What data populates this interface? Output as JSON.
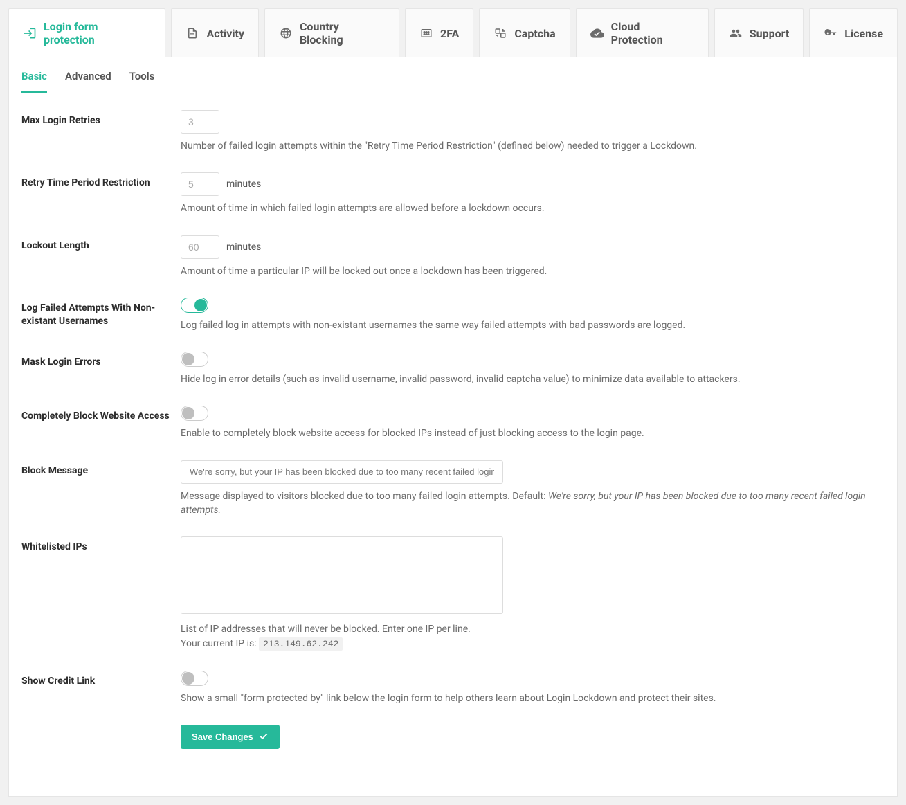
{
  "top_tabs": [
    {
      "label": "Login form protection"
    },
    {
      "label": "Activity"
    },
    {
      "label": "Country Blocking"
    },
    {
      "label": "2FA"
    },
    {
      "label": "Captcha"
    },
    {
      "label": "Cloud Protection"
    },
    {
      "label": "Support"
    },
    {
      "label": "License"
    }
  ],
  "sub_tabs": {
    "basic": "Basic",
    "advanced": "Advanced",
    "tools": "Tools"
  },
  "fields": {
    "max_login_retries": {
      "label": "Max Login Retries",
      "value": "3",
      "hint": "Number of failed login attempts within the \"Retry Time Period Restriction\" (defined below) needed to trigger a Lockdown."
    },
    "retry_time_period": {
      "label": "Retry Time Period Restriction",
      "value": "5",
      "unit": "minutes",
      "hint": "Amount of time in which failed login attempts are allowed before a lockdown occurs."
    },
    "lockout_length": {
      "label": "Lockout Length",
      "value": "60",
      "unit": "minutes",
      "hint": "Amount of time a particular IP will be locked out once a lockdown has been triggered."
    },
    "log_failed_nonexistant": {
      "label": "Log Failed Attempts With Non-existant Usernames",
      "hint": "Log failed log in attempts with non-existant usernames the same way failed attempts with bad passwords are logged."
    },
    "mask_login_errors": {
      "label": "Mask Login Errors",
      "hint": "Hide log in error details (such as invalid username, invalid password, invalid captcha value) to minimize data available to attackers."
    },
    "completely_block": {
      "label": "Completely Block Website Access",
      "hint": "Enable to completely block website access for blocked IPs instead of just blocking access to the login page."
    },
    "block_message": {
      "label": "Block Message",
      "placeholder": "We're sorry, but your IP has been blocked due to too many recent failed login attempts",
      "hint_prefix": "Message displayed to visitors blocked due to too many failed login attempts. Default: ",
      "hint_italic": "We're sorry, but your IP has been blocked due to too many recent failed login attempts."
    },
    "whitelisted_ips": {
      "label": "Whitelisted IPs",
      "hint_line1": "List of IP addresses that will never be blocked. Enter one IP per line.",
      "hint_line2_prefix": "Your current IP is: ",
      "ip": "213.149.62.242"
    },
    "show_credit_link": {
      "label": "Show Credit Link",
      "hint": "Show a small \"form protected by\" link below the login form to help others learn about Login Lockdown and protect their sites."
    }
  },
  "save_button": "Save Changes"
}
